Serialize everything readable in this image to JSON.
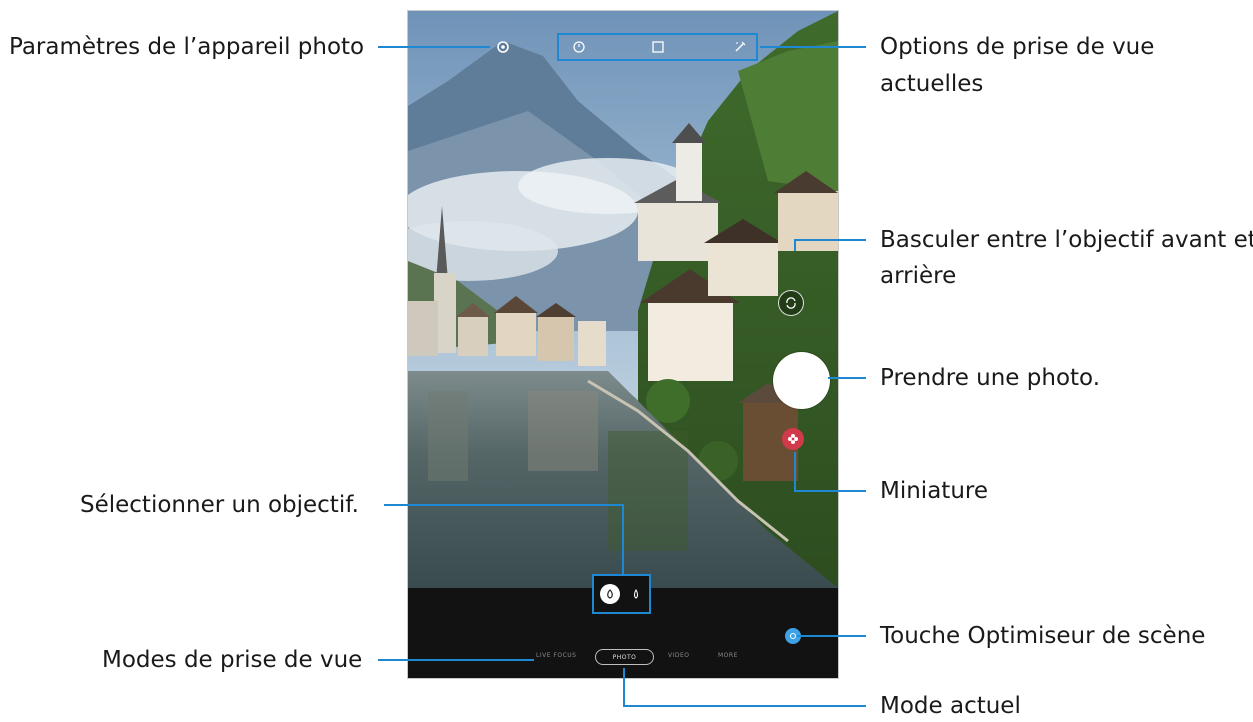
{
  "callouts": {
    "camera_settings": "Paramètres de l’appareil photo",
    "shooting_options": [
      "Options de prise de vue",
      "actuelles"
    ],
    "switch_lens": [
      "Basculer entre l’objectif avant et",
      "arrière"
    ],
    "take_photo": "Prendre une photo.",
    "thumbnail": "Miniature",
    "select_lens": "Sélectionner un objectif.",
    "scene_optimizer": "Touche Optimiseur de scène",
    "shooting_modes": "Modes de prise de vue",
    "current_mode": "Mode actuel"
  },
  "camera": {
    "top_icons": [
      "gear-icon",
      "timer-icon",
      "ratio-icon",
      "effects-icon"
    ],
    "lens_icons": [
      "wide-lens-icon",
      "ultra-wide-lens-icon"
    ],
    "modes": [
      "LIVE FOCUS",
      "PHOTO",
      "VIDEO",
      "MORE"
    ],
    "current_mode_index": 1
  },
  "colors": {
    "callout_line": "#1e88d2",
    "control_bar": "#121212",
    "thumbnail": "#d13a4b",
    "scene_optimizer": "#3ea2e6"
  }
}
